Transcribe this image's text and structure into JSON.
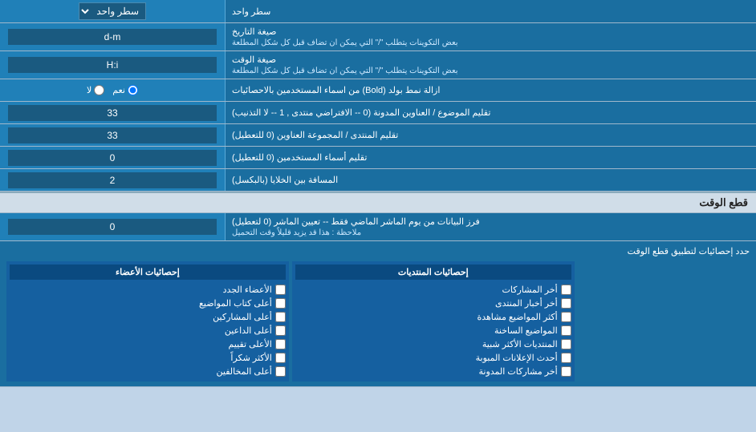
{
  "header": {
    "dropdown_label": "سطر واحد"
  },
  "rows": [
    {
      "id": "date-format",
      "label": "صيغة التاريخ",
      "sublabel": "بعض التكوينات يتطلب \"/\" التي يمكن ان تضاف قبل كل شكل المطلعة",
      "value": "d-m",
      "type": "text"
    },
    {
      "id": "time-format",
      "label": "صيغة الوقت",
      "sublabel": "بعض التكوينات يتطلب \"/\" التي يمكن ان تضاف قبل كل شكل المطلعة",
      "value": "H:i",
      "type": "text"
    },
    {
      "id": "bold-remove",
      "label": "ازالة نمط بولد (Bold) من اسماء المستخدمين بالاحصائيات",
      "value": "",
      "type": "radio",
      "options": [
        "نعم",
        "لا"
      ],
      "selected": "نعم"
    },
    {
      "id": "topic-titles",
      "label": "تقليم الموضوع / العناوين المدونة (0 -- الافتراضي منتدى , 1 -- لا التذنيب)",
      "value": "33",
      "type": "text"
    },
    {
      "id": "forum-titles",
      "label": "تقليم المنتدى / المجموعة العناوين (0 للتعطيل)",
      "value": "33",
      "type": "text"
    },
    {
      "id": "user-names",
      "label": "تقليم أسماء المستخدمين (0 للتعطيل)",
      "value": "0",
      "type": "text"
    },
    {
      "id": "cell-spacing",
      "label": "المسافة بين الخلايا (بالبكسل)",
      "value": "2",
      "type": "text"
    }
  ],
  "time_cut_section": {
    "header": "قطع الوقت",
    "row": {
      "label": "فرز البيانات من يوم الماشر الماضي فقط -- تعيين الماشر (0 لتعطيل)",
      "note": "ملاحظة : هذا قد يزيد قليلاً وقت التحميل",
      "value": "0",
      "type": "text"
    }
  },
  "stats_section": {
    "label": "حدد إحصائيات لتطبيق قطع الوقت",
    "columns": [
      {
        "header": "",
        "items": []
      },
      {
        "header": "إحصائيات المنتديات",
        "items": [
          "أخر المشاركات",
          "أخر أخبار المنتدى",
          "أكثر المواضيع مشاهدة",
          "المواضيع الساخنة",
          "المنتديات الأكثر شبية",
          "أحدث الإعلانات المبوبة",
          "أخر مشاركات المدونة"
        ]
      },
      {
        "header": "إحصائيات الأعضاء",
        "items": [
          "الأعضاء الجدد",
          "أعلى كتاب المواضيع",
          "أعلى المشاركين",
          "أعلى الداعين",
          "الأعلى تقييم",
          "الأكثر شكراً",
          "أعلى المخالفين"
        ]
      }
    ]
  }
}
